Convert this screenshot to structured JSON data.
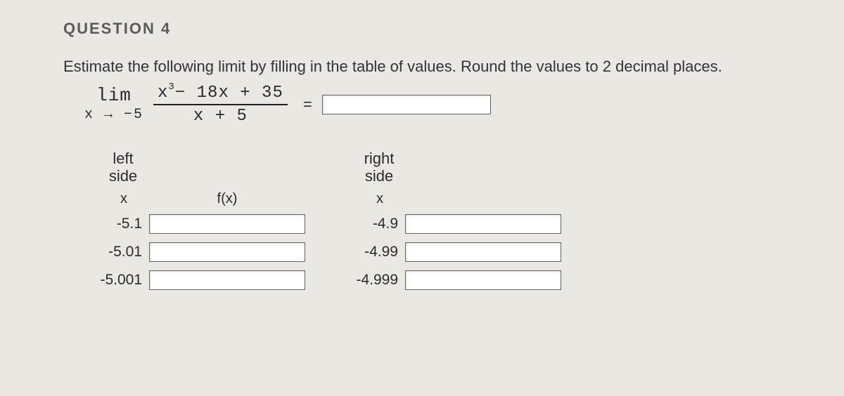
{
  "question": {
    "label": "QUESTION 4",
    "prompt": "Estimate the following limit by filling in the table of values. Round the values to 2 decimal places."
  },
  "limit": {
    "lim_text": "lim",
    "approach": "x → −5",
    "numerator_a": "x",
    "numerator_sup": "3",
    "numerator_b": "− 18x + 35",
    "denominator": "x + 5",
    "equals": "="
  },
  "tables": {
    "left": {
      "header_line1": "left",
      "header_line2": "side",
      "col_x": "x",
      "col_fx": "f(x)",
      "rows": [
        {
          "x": "-5.1"
        },
        {
          "x": "-5.01"
        },
        {
          "x": "-5.001"
        }
      ]
    },
    "right": {
      "header_line1": "right",
      "header_line2": "side",
      "col_x": "x",
      "rows": [
        {
          "x": "-4.9"
        },
        {
          "x": "-4.99"
        },
        {
          "x": "-4.999"
        }
      ]
    }
  }
}
